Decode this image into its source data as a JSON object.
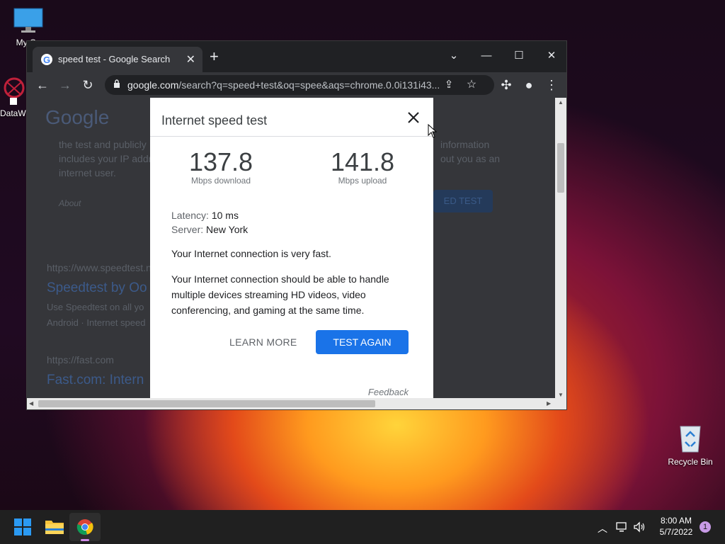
{
  "desktop": {
    "icons": [
      {
        "label": "My Co"
      },
      {
        "label": "DataW"
      },
      {
        "label": "Recycle Bin"
      }
    ]
  },
  "browser": {
    "tab": {
      "title": "speed test - Google Search",
      "close": "✕"
    },
    "new_tab": "+",
    "url": {
      "host": "google.com",
      "path": "/search?q=speed+test&oq=spee&aqs=chrome.0.0i131i43..."
    }
  },
  "background": {
    "logo": "Google",
    "lines": [
      "the test and publicly",
      "includes your IP addr",
      "internet user.",
      "About",
      "https://www.speedtest.n",
      "Speedtest by Oo",
      "Use Speedtest on all yo",
      "Android · Internet speed",
      "https://fast.com",
      "Fast.com: Intern",
      "information",
      "out you as an",
      "ED TEST"
    ]
  },
  "dialog": {
    "title": "Internet speed test",
    "download": {
      "value": "137.8",
      "unit": "Mbps download"
    },
    "upload": {
      "value": "141.8",
      "unit": "Mbps upload"
    },
    "latency": {
      "label": "Latency:",
      "value": "10 ms"
    },
    "server": {
      "label": "Server:",
      "value": "New York"
    },
    "summary": "Your Internet connection is very fast.",
    "detail": "Your Internet connection should be able to handle multiple devices streaming HD videos, video conferencing, and gaming at the same time.",
    "learn_more": "LEARN MORE",
    "test_again": "TEST AGAIN",
    "feedback": "Feedback"
  },
  "taskbar": {
    "time": "8:00 AM",
    "date": "5/7/2022",
    "notifications": "1"
  },
  "colors": {
    "accent": "#1a73e8",
    "chrome_dark": "#202124",
    "toolbar": "#35363a"
  }
}
